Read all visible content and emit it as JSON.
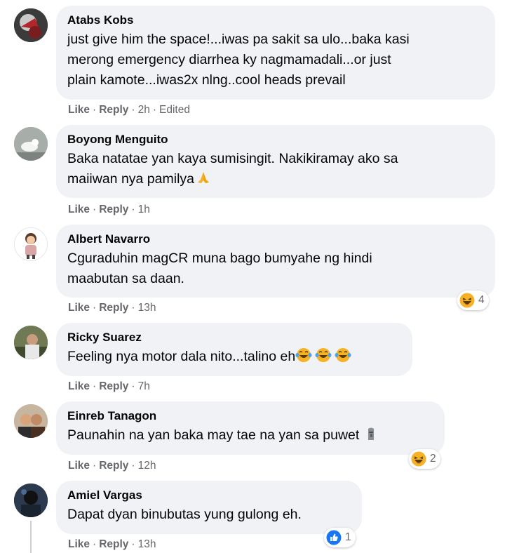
{
  "comments": [
    {
      "author": "Atabs Kobs",
      "lines": [
        "just give him the space!...iwas pa sakit sa ulo...baka kasi",
        "merong emergency diarrhea ky nagmamadali...or just",
        "plain kamote...iwas2x nlng..cool heads prevail"
      ],
      "like": "Like",
      "reply": "Reply",
      "time": "2h",
      "edited": "Edited"
    },
    {
      "author": "Boyong Menguito",
      "lines": [
        "Baka natatae yan kaya sumisingit. Nakikiramay ako sa",
        "maiiwan nya pamilya"
      ],
      "like": "Like",
      "reply": "Reply",
      "time": "1h"
    },
    {
      "author": "Albert Navarro",
      "lines": [
        "Cguraduhin magCR muna bago bumyahe ng hindi",
        "maabutan sa daan."
      ],
      "like": "Like",
      "reply": "Reply",
      "time": "13h",
      "reaction": {
        "icon": "laughing-emoji-icon",
        "count": "4"
      }
    },
    {
      "author": "Ricky Suarez",
      "lines": [
        "Feeling nya motor dala nito...talino eh"
      ],
      "like": "Like",
      "reply": "Reply",
      "time": "7h"
    },
    {
      "author": "Einreb Tanagon",
      "lines": [
        "Paunahin na yan baka may tae na yan sa puwet"
      ],
      "like": "Like",
      "reply": "Reply",
      "time": "12h",
      "reaction": {
        "icon": "laughing-emoji-icon",
        "count": "2"
      }
    },
    {
      "author": "Amiel Vargas",
      "lines": [
        "Dapat dyan binubutas yung gulong eh."
      ],
      "like": "Like",
      "reply": "Reply",
      "time": "13h",
      "reaction": {
        "icon": "like-icon",
        "count": "1"
      }
    }
  ],
  "colors": {
    "bubble": "#f0f2f5",
    "meta": "#65676b",
    "like_blue": "#1877f2",
    "emoji_yellow": "#f7b125"
  }
}
